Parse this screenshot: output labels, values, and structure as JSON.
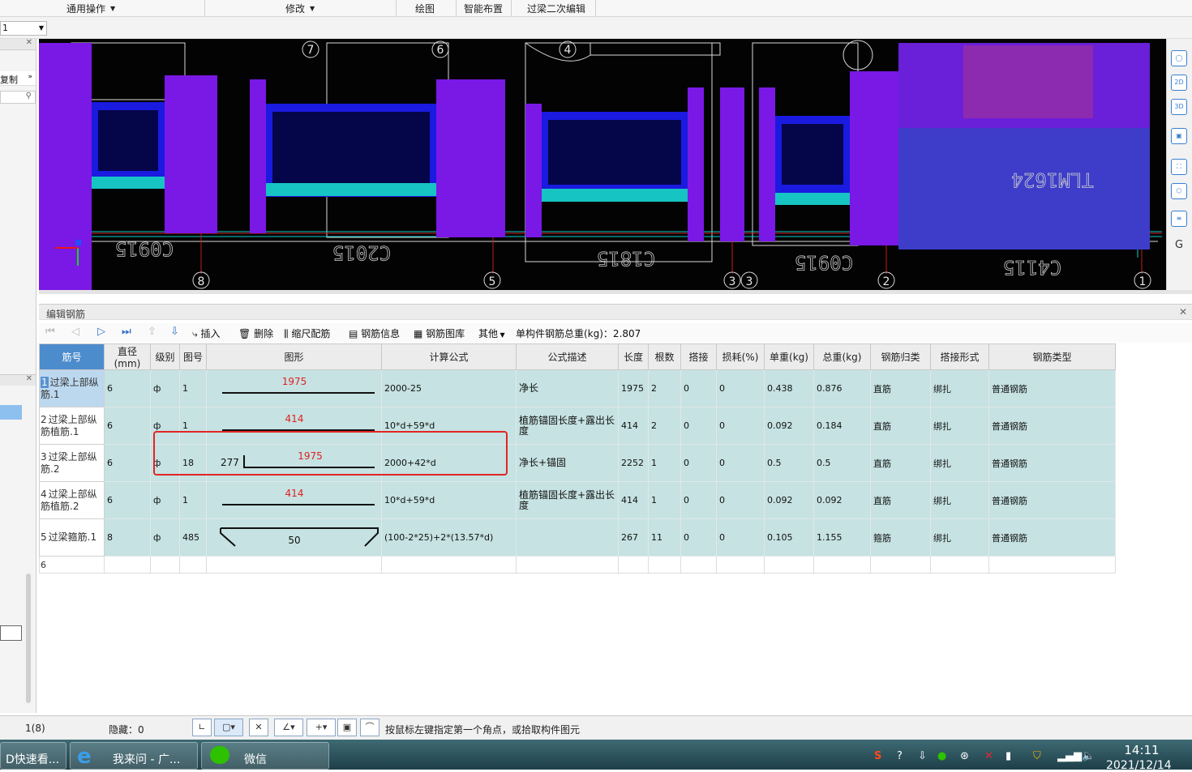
{
  "ribbon": {
    "groups": [
      "通用操作",
      "修改",
      "绘图",
      "智能布置",
      "过梁二次编辑"
    ]
  },
  "floor_select": {
    "value": "1"
  },
  "left_panel": {
    "label": "复制"
  },
  "viewport": {
    "axis_numbers_top": [
      "7",
      "6",
      "4"
    ],
    "axis_numbers_bottom": [
      "8",
      "5",
      "3",
      "3",
      "2",
      "1"
    ],
    "text_labels": [
      "C0915",
      "C2015",
      "C1815",
      "C0915",
      "C4115",
      "TLM1624"
    ],
    "view_tools": [
      "2D",
      "3D",
      "G"
    ]
  },
  "rebar_panel": {
    "title": "编辑钢筋",
    "toolbar": {
      "insert": "插入",
      "delete": "删除",
      "scale": "缩尺配筋",
      "info": "钢筋信息",
      "library": "钢筋图库",
      "other": "其他",
      "total_weight": "单构件钢筋总重(kg)：2.807"
    },
    "columns": [
      "筋号",
      "直径(mm)",
      "级别",
      "图号",
      "图形",
      "计算公式",
      "公式描述",
      "长度",
      "根数",
      "搭接",
      "损耗(%)",
      "单重(kg)",
      "总重(kg)",
      "钢筋归类",
      "搭接形式",
      "钢筋类型"
    ],
    "rows": [
      {
        "idx": "1",
        "name": "过梁上部纵筋.1",
        "dia": "6",
        "grade": "ф",
        "fig": "1",
        "shape_num": "1975",
        "shape_side": "",
        "formula": "2000-25",
        "desc": "净长",
        "len": "1975",
        "count": "2",
        "lap": "0",
        "loss": "0",
        "unit": "0.438",
        "total": "0.876",
        "cat": "直筋",
        "lapform": "绑扎",
        "type": "普通钢筋"
      },
      {
        "idx": "2",
        "name": "过梁上部纵筋植筋.1",
        "dia": "6",
        "grade": "ф",
        "fig": "1",
        "shape_num": "414",
        "shape_side": "",
        "formula": "10*d+59*d",
        "desc": "植筋锚固长度+露出长度",
        "len": "414",
        "count": "2",
        "lap": "0",
        "loss": "0",
        "unit": "0.092",
        "total": "0.184",
        "cat": "直筋",
        "lapform": "绑扎",
        "type": "普通钢筋"
      },
      {
        "idx": "3",
        "name": "过梁上部纵筋.2",
        "dia": "6",
        "grade": "ф",
        "fig": "18",
        "shape_num": "1975",
        "shape_side": "277",
        "formula": "2000+42*d",
        "desc": "净长+锚固",
        "len": "2252",
        "count": "1",
        "lap": "0",
        "loss": "0",
        "unit": "0.5",
        "total": "0.5",
        "cat": "直筋",
        "lapform": "绑扎",
        "type": "普通钢筋"
      },
      {
        "idx": "4",
        "name": "过梁上部纵筋植筋.2",
        "dia": "6",
        "grade": "ф",
        "fig": "1",
        "shape_num": "414",
        "shape_side": "",
        "formula": "10*d+59*d",
        "desc": "植筋锚固长度+露出长度",
        "len": "414",
        "count": "1",
        "lap": "0",
        "loss": "0",
        "unit": "0.092",
        "total": "0.092",
        "cat": "直筋",
        "lapform": "绑扎",
        "type": "普通钢筋"
      },
      {
        "idx": "5",
        "name": "过梁箍筋.1",
        "dia": "8",
        "grade": "ф",
        "fig": "485",
        "shape_num": "50",
        "shape_side": "",
        "formula": "(100-2*25)+2*(13.57*d)",
        "desc": "",
        "len": "267",
        "count": "11",
        "lap": "0",
        "loss": "0",
        "unit": "0.105",
        "total": "1.155",
        "cat": "箍筋",
        "lapform": "绑扎",
        "type": "普通钢筋"
      }
    ],
    "empty_row_idx": "6"
  },
  "statusbar": {
    "page": "1(8)",
    "hidden": "隐藏：0",
    "hint": "按鼠标左键指定第一个角点，或拾取构件图元"
  },
  "taskbar": {
    "items": [
      "D快速看...",
      "我来问 - 广...",
      "微信"
    ],
    "time": "14:11",
    "date": "2021/12/14"
  }
}
